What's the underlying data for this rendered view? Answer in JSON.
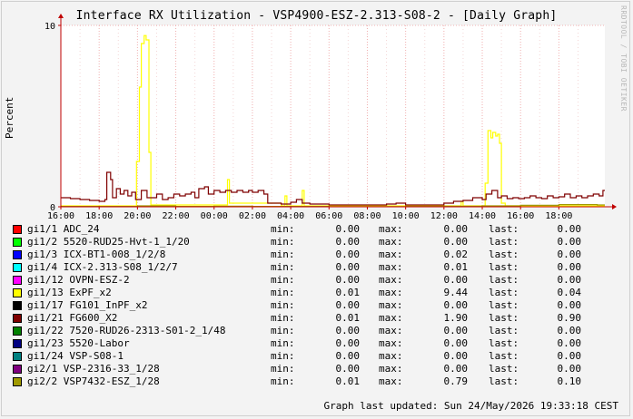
{
  "title": "Interface RX Utilization - VSP4900-ESZ-2.313-S08-2 - [Daily Graph]",
  "watermark": "RRDTOOL / TOBI OETIKER",
  "chart_data": {
    "type": "line",
    "ylabel": "Percent",
    "ylim": [
      0,
      10
    ],
    "y_ticks": [
      "0",
      "10"
    ],
    "x_ticks": [
      "16:00",
      "18:00",
      "20:00",
      "22:00",
      "00:00",
      "02:00",
      "04:00",
      "06:00",
      "08:00",
      "10:00",
      "12:00",
      "14:00",
      "16:00",
      "18:00"
    ],
    "x_range_hours": [
      16,
      44.4
    ],
    "grid": true,
    "series": [
      {
        "name": "gi1/13 ExPF_x2",
        "color": "#ffff00",
        "points": [
          [
            16,
            0.05
          ],
          [
            19.9,
            0.05
          ],
          [
            19.95,
            2.5
          ],
          [
            20.1,
            6.6
          ],
          [
            20.2,
            9.0
          ],
          [
            20.35,
            9.44
          ],
          [
            20.45,
            9.2
          ],
          [
            20.6,
            3.0
          ],
          [
            20.7,
            0.1
          ],
          [
            24.5,
            0.1
          ],
          [
            24.7,
            1.5
          ],
          [
            24.8,
            0.2
          ],
          [
            27.5,
            0.05
          ],
          [
            27.7,
            0.6
          ],
          [
            27.8,
            0.05
          ],
          [
            28.5,
            0.05
          ],
          [
            28.6,
            0.9
          ],
          [
            28.7,
            0.05
          ],
          [
            36.8,
            0.05
          ],
          [
            36.9,
            0.3
          ],
          [
            37.0,
            0.05
          ],
          [
            38.0,
            0.05
          ],
          [
            38.15,
            1.3
          ],
          [
            38.3,
            4.2
          ],
          [
            38.45,
            3.8
          ],
          [
            38.55,
            4.1
          ],
          [
            38.7,
            3.9
          ],
          [
            38.8,
            4.0
          ],
          [
            38.9,
            3.5
          ],
          [
            39.0,
            0.2
          ],
          [
            39.2,
            0.05
          ],
          [
            44.4,
            0.05
          ]
        ]
      },
      {
        "name": "gi1/21 FG600_X2",
        "color": "#7f0000",
        "points": [
          [
            16,
            0.5
          ],
          [
            16.5,
            0.45
          ],
          [
            17,
            0.4
          ],
          [
            17.5,
            0.35
          ],
          [
            18,
            0.3
          ],
          [
            18.3,
            0.4
          ],
          [
            18.4,
            1.9
          ],
          [
            18.6,
            1.5
          ],
          [
            18.7,
            0.5
          ],
          [
            18.9,
            1.0
          ],
          [
            19.1,
            0.7
          ],
          [
            19.3,
            0.9
          ],
          [
            19.5,
            0.6
          ],
          [
            19.7,
            0.8
          ],
          [
            19.9,
            0.4
          ],
          [
            20.2,
            0.9
          ],
          [
            20.5,
            0.5
          ],
          [
            20.8,
            0.5
          ],
          [
            21.0,
            0.7
          ],
          [
            21.3,
            0.4
          ],
          [
            21.6,
            0.5
          ],
          [
            21.9,
            0.7
          ],
          [
            22.2,
            0.6
          ],
          [
            22.5,
            0.7
          ],
          [
            22.8,
            0.8
          ],
          [
            23.0,
            0.5
          ],
          [
            23.2,
            1.0
          ],
          [
            23.5,
            1.1
          ],
          [
            23.7,
            0.7
          ],
          [
            24.0,
            0.9
          ],
          [
            24.3,
            0.8
          ],
          [
            24.6,
            0.9
          ],
          [
            24.9,
            0.8
          ],
          [
            25.2,
            0.9
          ],
          [
            25.5,
            0.8
          ],
          [
            25.8,
            0.9
          ],
          [
            26.0,
            0.8
          ],
          [
            26.3,
            0.9
          ],
          [
            26.6,
            0.7
          ],
          [
            26.8,
            0.2
          ],
          [
            27.0,
            0.2
          ],
          [
            27.5,
            0.15
          ],
          [
            28.0,
            0.25
          ],
          [
            28.3,
            0.4
          ],
          [
            28.6,
            0.2
          ],
          [
            29.0,
            0.15
          ],
          [
            30.0,
            0.1
          ],
          [
            31.0,
            0.1
          ],
          [
            32.0,
            0.1
          ],
          [
            33.0,
            0.15
          ],
          [
            33.5,
            0.2
          ],
          [
            34.0,
            0.1
          ],
          [
            35.0,
            0.1
          ],
          [
            36.0,
            0.2
          ],
          [
            36.5,
            0.3
          ],
          [
            37.0,
            0.35
          ],
          [
            37.5,
            0.5
          ],
          [
            38.0,
            0.4
          ],
          [
            38.2,
            0.7
          ],
          [
            38.5,
            0.9
          ],
          [
            38.8,
            0.5
          ],
          [
            39.0,
            0.6
          ],
          [
            39.3,
            0.45
          ],
          [
            39.6,
            0.5
          ],
          [
            39.9,
            0.45
          ],
          [
            40.2,
            0.5
          ],
          [
            40.5,
            0.6
          ],
          [
            40.8,
            0.5
          ],
          [
            41.1,
            0.45
          ],
          [
            41.4,
            0.6
          ],
          [
            41.7,
            0.5
          ],
          [
            42.0,
            0.55
          ],
          [
            42.3,
            0.7
          ],
          [
            42.6,
            0.5
          ],
          [
            42.9,
            0.6
          ],
          [
            43.2,
            0.5
          ],
          [
            43.5,
            0.6
          ],
          [
            43.8,
            0.7
          ],
          [
            44.1,
            0.6
          ],
          [
            44.3,
            0.9
          ],
          [
            44.4,
            0.9
          ]
        ]
      },
      {
        "name": "gi2/2 VSP7432-ESZ_1/28",
        "color": "#a09a00",
        "points": [
          [
            16,
            0.02
          ],
          [
            18,
            0.02
          ],
          [
            20,
            0.05
          ],
          [
            22,
            0.02
          ],
          [
            24,
            0.03
          ],
          [
            26,
            0.02
          ],
          [
            28,
            0.02
          ],
          [
            30,
            0.01
          ],
          [
            32,
            0.01
          ],
          [
            34,
            0.02
          ],
          [
            36,
            0.03
          ],
          [
            38,
            0.05
          ],
          [
            40,
            0.08
          ],
          [
            42,
            0.12
          ],
          [
            44,
            0.1
          ],
          [
            44.4,
            0.1
          ]
        ]
      }
    ],
    "legend": [
      {
        "name": "gi1/1 ADC_24",
        "color": "#ff0000",
        "min": "0.00",
        "max": "0.00",
        "last": "0.00"
      },
      {
        "name": "gi1/2 5520-RUD25-Hvt-1_1/20",
        "color": "#00ff00",
        "min": "0.00",
        "max": "0.00",
        "last": "0.00"
      },
      {
        "name": "gi1/3 ICX-BT1-008_1/2/8",
        "color": "#0000ff",
        "min": "0.00",
        "max": "0.02",
        "last": "0.00"
      },
      {
        "name": "gi1/4 ICX-2.313-S08_1/2/7",
        "color": "#00ffff",
        "min": "0.00",
        "max": "0.01",
        "last": "0.00"
      },
      {
        "name": "gi1/12 OVPN-ESZ-2",
        "color": "#ff00ff",
        "min": "0.00",
        "max": "0.00",
        "last": "0.00"
      },
      {
        "name": "gi1/13 ExPF_x2",
        "color": "#ffff00",
        "min": "0.01",
        "max": "9.44",
        "last": "0.04"
      },
      {
        "name": "gi1/17 FG101_InPF_x2",
        "color": "#000000",
        "min": "0.00",
        "max": "0.00",
        "last": "0.00"
      },
      {
        "name": "gi1/21 FG600_X2",
        "color": "#7f0000",
        "min": "0.01",
        "max": "1.90",
        "last": "0.90"
      },
      {
        "name": "gi1/22 7520-RUD26-2313-S01-2_1/48",
        "color": "#008000",
        "min": "0.00",
        "max": "0.00",
        "last": "0.00"
      },
      {
        "name": "gi1/23 5520-Labor",
        "color": "#000080",
        "min": "0.00",
        "max": "0.00",
        "last": "0.00"
      },
      {
        "name": "gi1/24 VSP-S08-1",
        "color": "#008080",
        "min": "0.00",
        "max": "0.00",
        "last": "0.00"
      },
      {
        "name": "gi2/1 VSP-2316-33_1/28",
        "color": "#800080",
        "min": "0.00",
        "max": "0.00",
        "last": "0.00"
      },
      {
        "name": "gi2/2 VSP7432-ESZ_1/28",
        "color": "#a09a00",
        "min": "0.01",
        "max": "0.79",
        "last": "0.10"
      }
    ],
    "labels": {
      "min": "min:",
      "max": "max:",
      "last": "last:"
    }
  },
  "updated": "Graph last updated: Sun 24/May/2026 19:33:18 CEST"
}
